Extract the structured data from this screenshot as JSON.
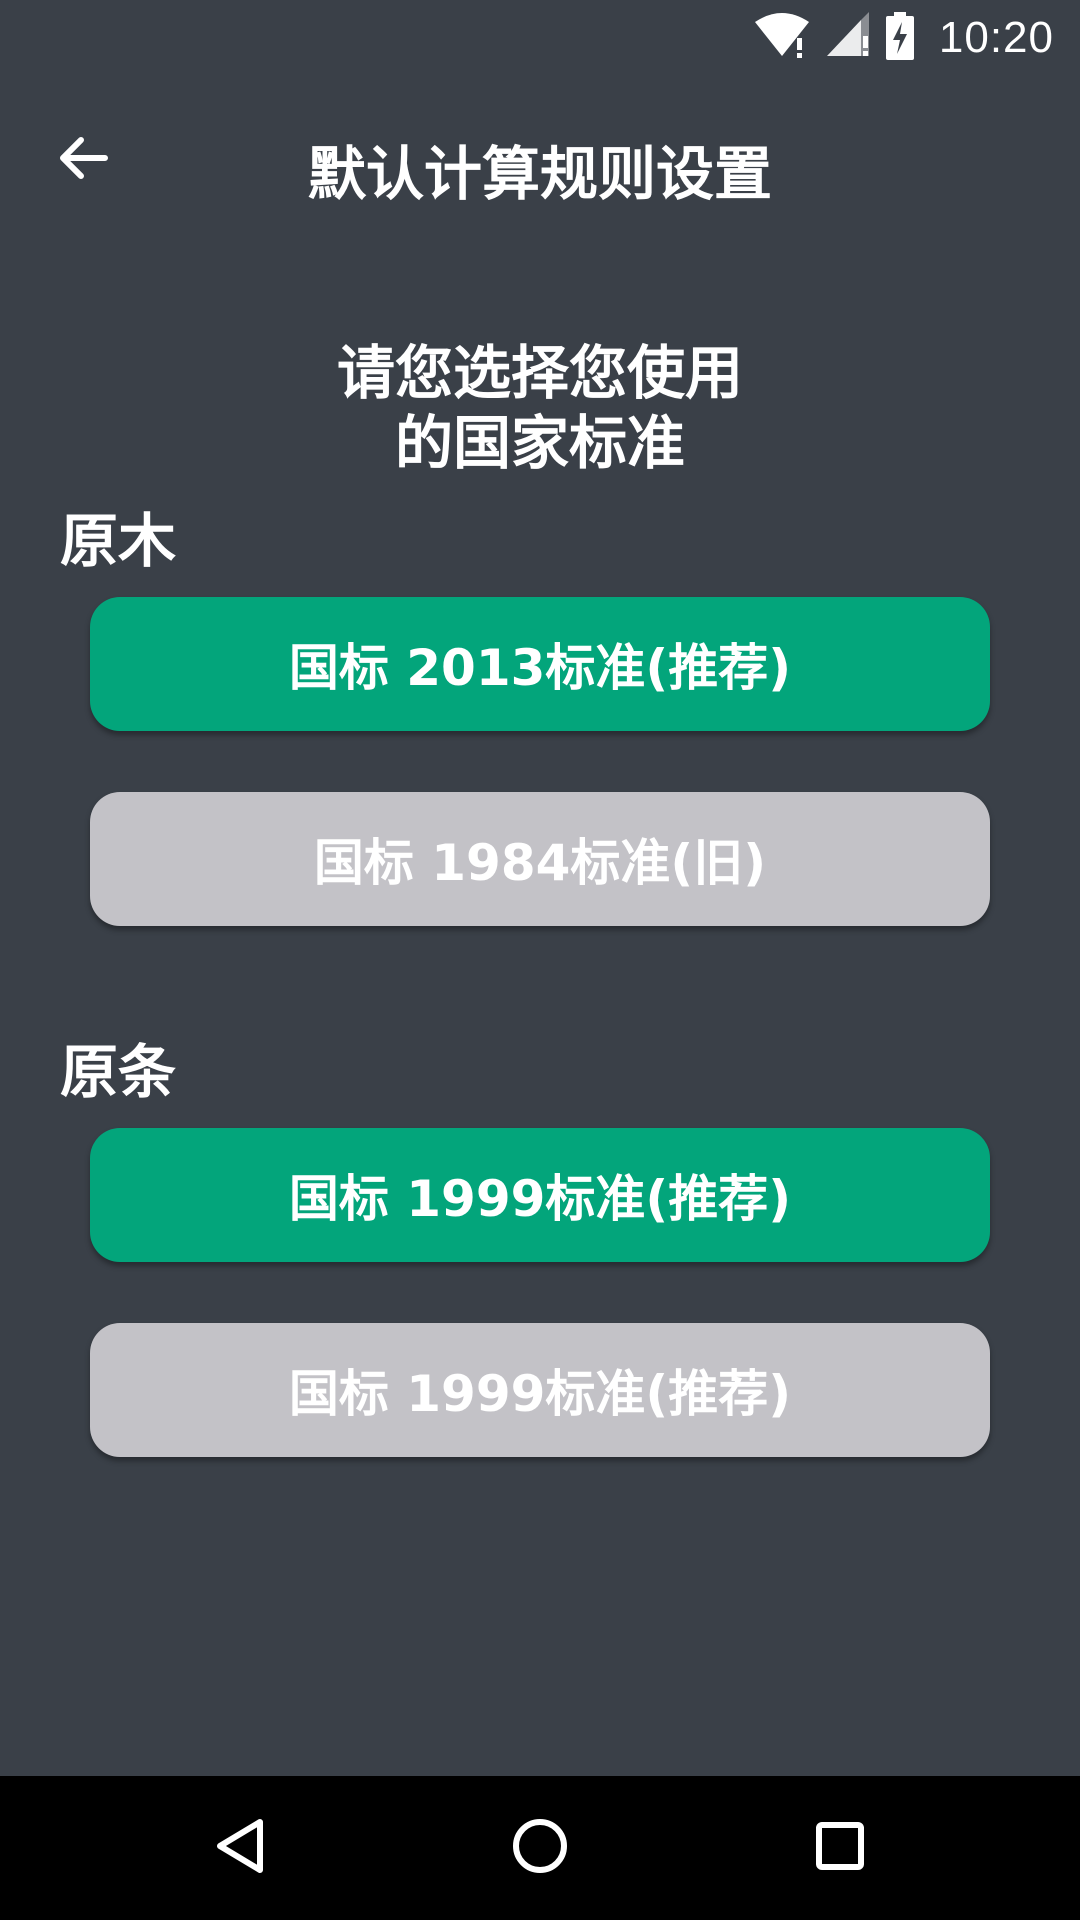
{
  "status_bar": {
    "time": "10:20",
    "icons": [
      "wifi-icon",
      "signal-icon",
      "battery-charging-icon"
    ]
  },
  "header": {
    "title": "默认计算规则设置",
    "back_icon": "arrow-left-icon"
  },
  "prompt": {
    "line1": "请您选择您使用",
    "line2": "的国家标准"
  },
  "sections": [
    {
      "label": "原木",
      "options": [
        {
          "label": "国标 2013标准(推荐)",
          "selected": true
        },
        {
          "label": "国标 1984标准(旧)",
          "selected": false
        }
      ]
    },
    {
      "label": "原条",
      "options": [
        {
          "label": "国标 1999标准(推荐)",
          "selected": true
        },
        {
          "label": "国标 1999标准(推荐)",
          "selected": false
        }
      ]
    }
  ],
  "colors": {
    "background": "#3a4048",
    "selected": "#03a57b",
    "unselected": "#c3c2c7",
    "nav_bar": "#000000"
  },
  "nav_bar": {
    "buttons": [
      "back-triangle-icon",
      "home-circle-icon",
      "recents-square-icon"
    ]
  }
}
